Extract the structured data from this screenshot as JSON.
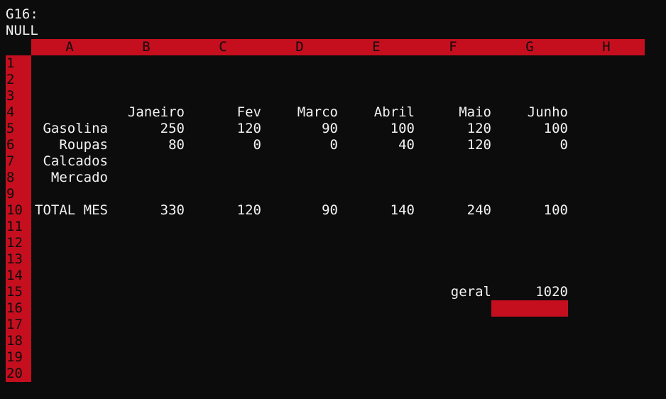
{
  "status": {
    "cell_ref": "G16:",
    "cell_value": "NULL"
  },
  "columns": [
    "A",
    "B",
    "C",
    "D",
    "E",
    "F",
    "G",
    "H"
  ],
  "rows": [
    "1",
    "2",
    "3",
    "4",
    "5",
    "6",
    "7",
    "8",
    "9",
    "10",
    "11",
    "12",
    "13",
    "14",
    "15",
    "16",
    "17",
    "18",
    "19",
    "20"
  ],
  "cells": {
    "B4": "Janeiro",
    "C4": "Fev",
    "D4": "Marco",
    "E4": "Abril",
    "F4": "Maio",
    "G4": "Junho",
    "A5": "Gasolina",
    "B5": "250",
    "C5": "120",
    "D5": "90",
    "E5": "100",
    "F5": "120",
    "G5": "100",
    "A6": "Roupas",
    "B6": "80",
    "C6": "0",
    "D6": "0",
    "E6": "40",
    "F6": "120",
    "G6": "0",
    "A7": "Calcados",
    "A8": "Mercado",
    "A10": "TOTAL MES",
    "B10": "330",
    "C10": "120",
    "D10": "90",
    "E10": "140",
    "F10": "240",
    "G10": "100",
    "F15": "geral",
    "G15": "1020"
  },
  "active_cell": "G16",
  "colors": {
    "background": "#0c0c0c",
    "text": "#f2f2f2",
    "header": "#c50f1f"
  }
}
